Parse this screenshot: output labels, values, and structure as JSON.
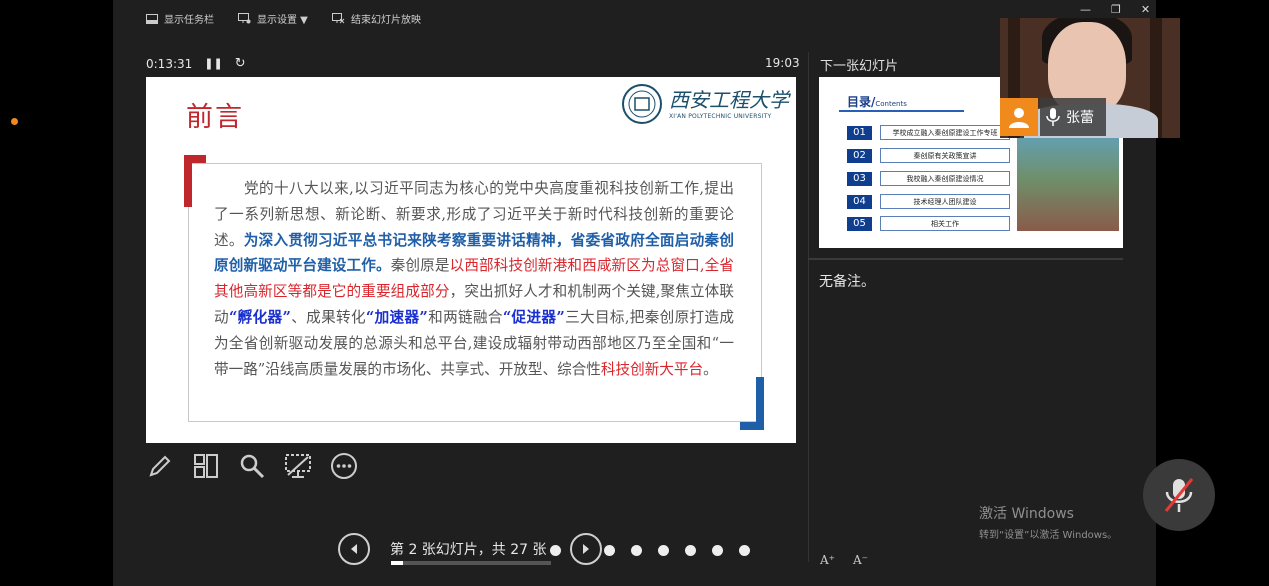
{
  "toolbar": {
    "show_taskbar": "显示任务栏",
    "display_settings": "显示设置 ▼",
    "end_show": "结束幻灯片放映"
  },
  "timer": {
    "elapsed": "0:13:31",
    "clock": "19:03"
  },
  "slide": {
    "title": "前言",
    "logo_name": "西安工程大学",
    "logo_en": "XI'AN POLYTECHNIC UNIVERSITY",
    "body": [
      {
        "style": "normal",
        "text": "　　党的十八大以来,以习近平同志为核心的党中央高度重视科技创新工作,提出了一系列新思想、新论断、新要求,形成了习近平关于新时代科技创新的重要论述。"
      },
      {
        "style": "blue",
        "text": "为深入贯彻习近平总书记来陕考察重要讲话精神，省委省政府全面启动秦创原创新驱动平台建设工作。"
      },
      {
        "style": "normal",
        "text": "秦创原是"
      },
      {
        "style": "red",
        "text": "以西部科技创新港和西咸新区为总窗口,全省其他高新区等都是它的重要组成部分"
      },
      {
        "style": "normal",
        "text": "，突出抓好人才和机制两个关键,聚焦立体联动"
      },
      {
        "style": "dblue",
        "text": "“孵化器”"
      },
      {
        "style": "normal",
        "text": "、成果转化"
      },
      {
        "style": "dblue",
        "text": "“加速器”"
      },
      {
        "style": "normal",
        "text": "和两链融合"
      },
      {
        "style": "dblue",
        "text": "“促进器”"
      },
      {
        "style": "normal",
        "text": "三大目标,把秦创原打造成为全省创新驱动发展的总源头和总平台,建设成辐射带动西部地区乃至全国和“一带一路”沿线高质量发展的市场化、共享式、开放型、综合性"
      },
      {
        "style": "red",
        "text": "科技创新大平台"
      },
      {
        "style": "normal",
        "text": "。"
      }
    ]
  },
  "next": {
    "label": "下一张幻灯片",
    "toc_title": "目录/",
    "toc_sub": "Contents",
    "items": [
      {
        "num": "01",
        "label": "学校成立融入秦创原建设工作专班"
      },
      {
        "num": "02",
        "label": "秦创原有关政策宣讲"
      },
      {
        "num": "03",
        "label": "我校融入秦创原建设情况"
      },
      {
        "num": "04",
        "label": "技术经理人团队建设"
      },
      {
        "num": "05",
        "label": "相关工作"
      }
    ]
  },
  "notes": {
    "text": "无备注。"
  },
  "font_buttons": {
    "increase": "A⁺",
    "decrease": "A⁻"
  },
  "nav": {
    "counter": "第 2 张幻灯片，共 27 张",
    "progress": 0.074
  },
  "participant": {
    "name": "张蕾"
  },
  "activation": {
    "line1": "激活 Windows",
    "line2": "转到“设置”以激活 Windows。"
  },
  "colors": {
    "slide_red": "#c0272d",
    "slide_blue": "#1f5fa8",
    "avatar_orange": "#f08a1c"
  }
}
